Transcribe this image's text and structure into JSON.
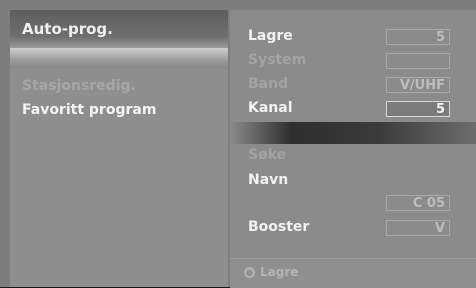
{
  "left_panel": {
    "header": "Auto-prog.",
    "items": [
      "Stasjonsredig.",
      "Favoritt program"
    ]
  },
  "right_panel": {
    "rows": [
      {
        "label": "Lagre",
        "value": "5"
      },
      {
        "label": "System",
        "value": ""
      },
      {
        "label": "Band",
        "value": "V/UHF"
      },
      {
        "label": "Kanal",
        "value": "5"
      },
      {
        "label": "Søke",
        "value": ""
      },
      {
        "label": "Navn",
        "value": ""
      },
      {
        "label": "",
        "value": "C 05"
      },
      {
        "label": "Booster",
        "value": "V"
      }
    ]
  },
  "footer": {
    "icon": "circle-button-icon",
    "label": "Lagre"
  }
}
